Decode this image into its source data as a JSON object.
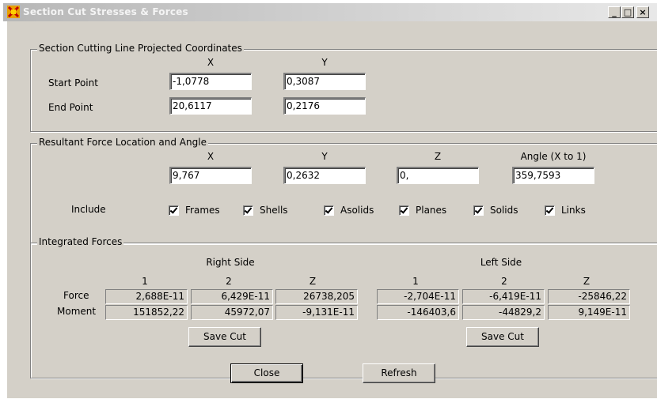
{
  "window": {
    "title": "Section Cut Stresses & Forces",
    "controls": {
      "minimize": "_",
      "maximize": "□",
      "close": "×"
    }
  },
  "projected": {
    "legend": "Section Cutting Line Projected Coordinates",
    "col_x": "X",
    "col_y": "Y",
    "start_label": "Start Point",
    "start_x": "-1,0778",
    "start_y": "0,3087",
    "end_label": "End Point",
    "end_x": "20,6117",
    "end_y": "0,2176"
  },
  "resultant": {
    "legend": "Resultant Force Location and Angle",
    "col_x": "X",
    "col_y": "Y",
    "col_z": "Z",
    "col_angle": "Angle (X to 1)",
    "x": "9,767",
    "y": "0,2632",
    "z": "0,",
    "angle": "359,7593",
    "include_label": "Include",
    "include": [
      {
        "label": "Frames",
        "checked": true
      },
      {
        "label": "Shells",
        "checked": true
      },
      {
        "label": "Asolids",
        "checked": true
      },
      {
        "label": "Planes",
        "checked": true
      },
      {
        "label": "Solids",
        "checked": true
      },
      {
        "label": "Links",
        "checked": true
      }
    ]
  },
  "integrated": {
    "legend": "Integrated Forces",
    "right_side": "Right Side",
    "left_side": "Left Side",
    "cols": [
      "1",
      "2",
      "Z"
    ],
    "force_label": "Force",
    "moment_label": "Moment",
    "right_force": [
      "2,688E-11",
      "6,429E-11",
      "26738,205"
    ],
    "right_moment": [
      "151852,22",
      "45972,07",
      "-9,131E-11"
    ],
    "left_force": [
      "-2,704E-11",
      "-6,419E-11",
      "-25846,22"
    ],
    "left_moment": [
      "-146403,6",
      "-44829,2",
      "9,149E-11"
    ],
    "save_cut": "Save Cut"
  },
  "footer": {
    "close": "Close",
    "refresh": "Refresh"
  }
}
